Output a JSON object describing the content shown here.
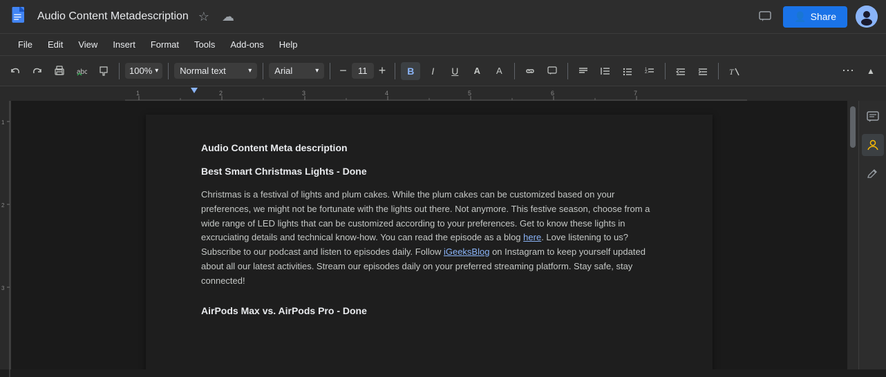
{
  "titleBar": {
    "appName": "Audio Content Metadescription",
    "starIcon": "★",
    "cloudIcon": "☁",
    "shareLabel": "Share",
    "shareIconUnicode": "👤",
    "moreOptionsIcon": "⋮",
    "chatIcon": "💬"
  },
  "menuBar": {
    "items": [
      "File",
      "Edit",
      "View",
      "Insert",
      "Format",
      "Tools",
      "Add-ons",
      "Help"
    ]
  },
  "toolbar": {
    "undoIcon": "↺",
    "redoIcon": "↻",
    "printIcon": "🖨",
    "spellIcon": "✓",
    "paintIcon": "🎨",
    "zoomValue": "100%",
    "styleLabel": "Normal text",
    "fontLabel": "Arial",
    "fontSizeValue": "11",
    "boldLabel": "B",
    "italicLabel": "I",
    "underlineLabel": "U",
    "textColorIcon": "A",
    "highlightIcon": "A",
    "linkIcon": "🔗",
    "commentIcon": "💬",
    "alignIcon": "≡",
    "listIcon": "≡",
    "numberedListIcon": "≡",
    "moreIcon": "⋯",
    "upArrowIcon": "▲"
  },
  "ruler": {
    "marks": [
      "1",
      "",
      "",
      "",
      "2",
      "",
      "",
      "",
      "3",
      "",
      "",
      "",
      "4",
      "",
      "",
      "",
      "5",
      "",
      "",
      "",
      "6",
      "",
      "",
      "",
      "7",
      "",
      ""
    ]
  },
  "document": {
    "title": "Audio Content Meta description",
    "section1Title": "Best Smart Christmas Lights - Done",
    "section1Body1": "Christmas is a festival of lights and plum cakes. While the plum cakes can be customized based on your preferences, we might not be fortunate with the lights out there. Not anymore. This festive season, choose from a wide range of LED lights that can be customized according to your preferences. Get to know these lights in excruciating details and technical know-how. You can read the episode as a blog ",
    "section1LinkText": "here",
    "section1Body2": ". Love listening to us? Subscribe to our podcast and listen to episodes daily. Follow ",
    "section1Link2Text": "iGeeksBlog",
    "section1Body3": " on Instagram to keep yourself updated about all our latest activities. Stream our episodes daily on your preferred streaming platform. Stay safe, stay connected!",
    "section2Title": "AirPods Max vs. AirPods Pro - Done"
  },
  "rightSidebar": {
    "chatIconLabel": "chat-icon",
    "personIconLabel": "person-icon",
    "editIconLabel": "edit-icon"
  },
  "leftRuler": {
    "marks": [
      "1",
      "",
      "2",
      "3"
    ]
  }
}
